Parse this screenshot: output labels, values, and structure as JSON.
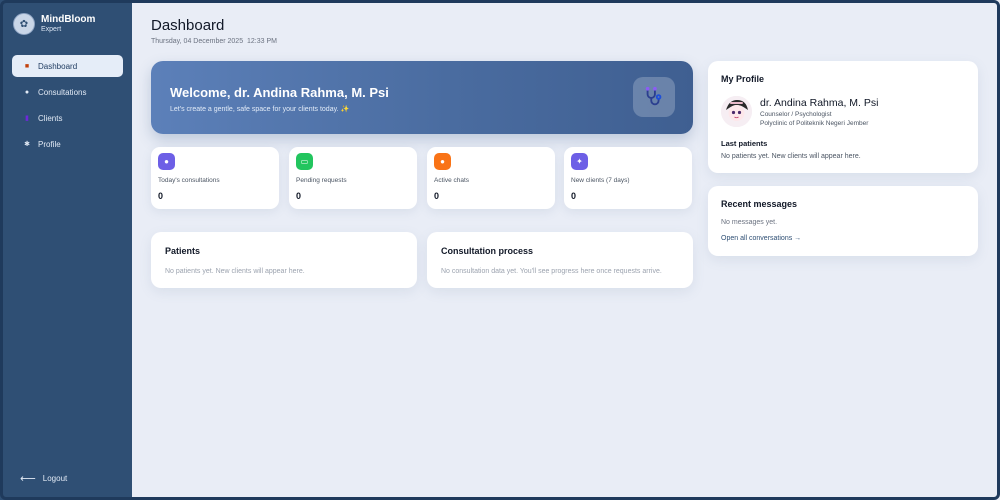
{
  "brand": {
    "name": "MindBloom",
    "subtitle": "Expert",
    "logo_icon": "brain-icon"
  },
  "sidebar": {
    "items": [
      {
        "label": "Dashboard",
        "icon": "dashboard-icon",
        "active": true
      },
      {
        "label": "Consultations",
        "icon": "chat-bubble-icon",
        "active": false
      },
      {
        "label": "Clients",
        "icon": "clients-icon",
        "active": false
      },
      {
        "label": "Profile",
        "icon": "gear-icon",
        "active": false
      }
    ],
    "logout_label": "Logout"
  },
  "header": {
    "title": "Dashboard",
    "datetime": "Thursday, 04 December 2025  12:33 PM"
  },
  "welcome": {
    "title": "Welcome, dr. Andina Rahma, M. Psi",
    "subtitle": "Let's create a gentle, safe space for your clients today. ✨",
    "badge_icon": "stethoscope-icon"
  },
  "stats": [
    {
      "label": "Today's consultations",
      "value": "0",
      "icon": "user-icon",
      "color": "#6d5fe6"
    },
    {
      "label": "Pending requests",
      "value": "0",
      "icon": "inbox-icon",
      "color": "#22c55e"
    },
    {
      "label": "Active chats",
      "value": "0",
      "icon": "chat-icon",
      "color": "#f97316"
    },
    {
      "label": "New clients (7 days)",
      "value": "0",
      "icon": "sparkle-icon",
      "color": "#6d5fe6"
    }
  ],
  "patients": {
    "title": "Patients",
    "empty": "No patients yet. New clients will appear here."
  },
  "process": {
    "title": "Consultation process",
    "empty": "No consultation data yet. You'll see progress here once requests arrive."
  },
  "profile": {
    "title": "My Profile",
    "name": "dr. Andina Rahma, M. Psi",
    "role": "Counselor / Psychologist",
    "org": "Polyclinic of Politeknik Negeri Jember",
    "last_patients_label": "Last patients",
    "last_patients_empty": "No patients yet. New clients will appear here."
  },
  "messages": {
    "title": "Recent messages",
    "empty": "No messages yet.",
    "link": "Open all conversations →"
  },
  "colors": {
    "sidebar": "#2f4f74",
    "accent": "#4a6ca0",
    "background": "#e9edf6"
  }
}
